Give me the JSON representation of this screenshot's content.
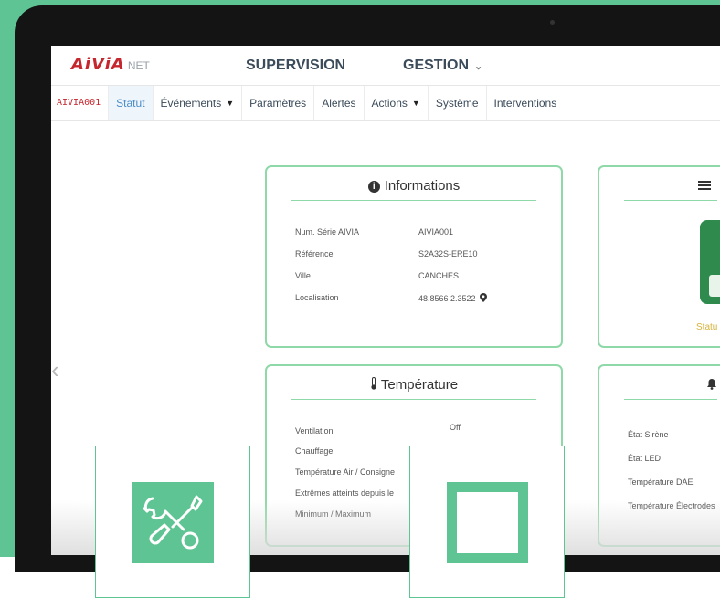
{
  "header": {
    "logo_main": "AiViA",
    "logo_suffix": "NET",
    "nav_supervision": "SUPERVISION",
    "nav_gestion": "GESTION"
  },
  "subnav": {
    "device_id": "AIVIA001",
    "items": [
      "Statut",
      "Événements",
      "Paramètres",
      "Alertes",
      "Actions",
      "Système",
      "Interventions"
    ],
    "active": "Statut"
  },
  "informations": {
    "title": "Informations",
    "rows": [
      {
        "label": "Num. Série AIVIA",
        "value": "AIVIA001"
      },
      {
        "label": "Référence",
        "value": "S2A32S-ERE10"
      },
      {
        "label": "Ville",
        "value": "CANCHES"
      },
      {
        "label": "Localisation",
        "value": "48.8566 2.3522"
      }
    ]
  },
  "temperature": {
    "title": "Température",
    "rows": [
      {
        "label": "Ventilation",
        "value": "Off"
      },
      {
        "label": "Chauffage",
        "value": ""
      },
      {
        "label": "Température Air / Consigne",
        "value": ""
      },
      {
        "label": "Extrêmes atteints depuis le",
        "value": ""
      },
      {
        "label": "Minimum / Maximum",
        "value": ""
      }
    ]
  },
  "right_card_2": {
    "rows": [
      "État Sirène",
      "État LED",
      "Température DAE",
      "Température Électrodes"
    ]
  },
  "right_card_1": {
    "status_label": "Statu"
  },
  "colors": {
    "brand_green": "#5fc493",
    "card_border": "#8fd9a8",
    "brand_red": "#c6262e"
  },
  "icons": [
    "tools-icon",
    "square-icon",
    "info-icon",
    "thermometer-icon",
    "location-pin-icon",
    "list-icon",
    "bell-icon"
  ]
}
